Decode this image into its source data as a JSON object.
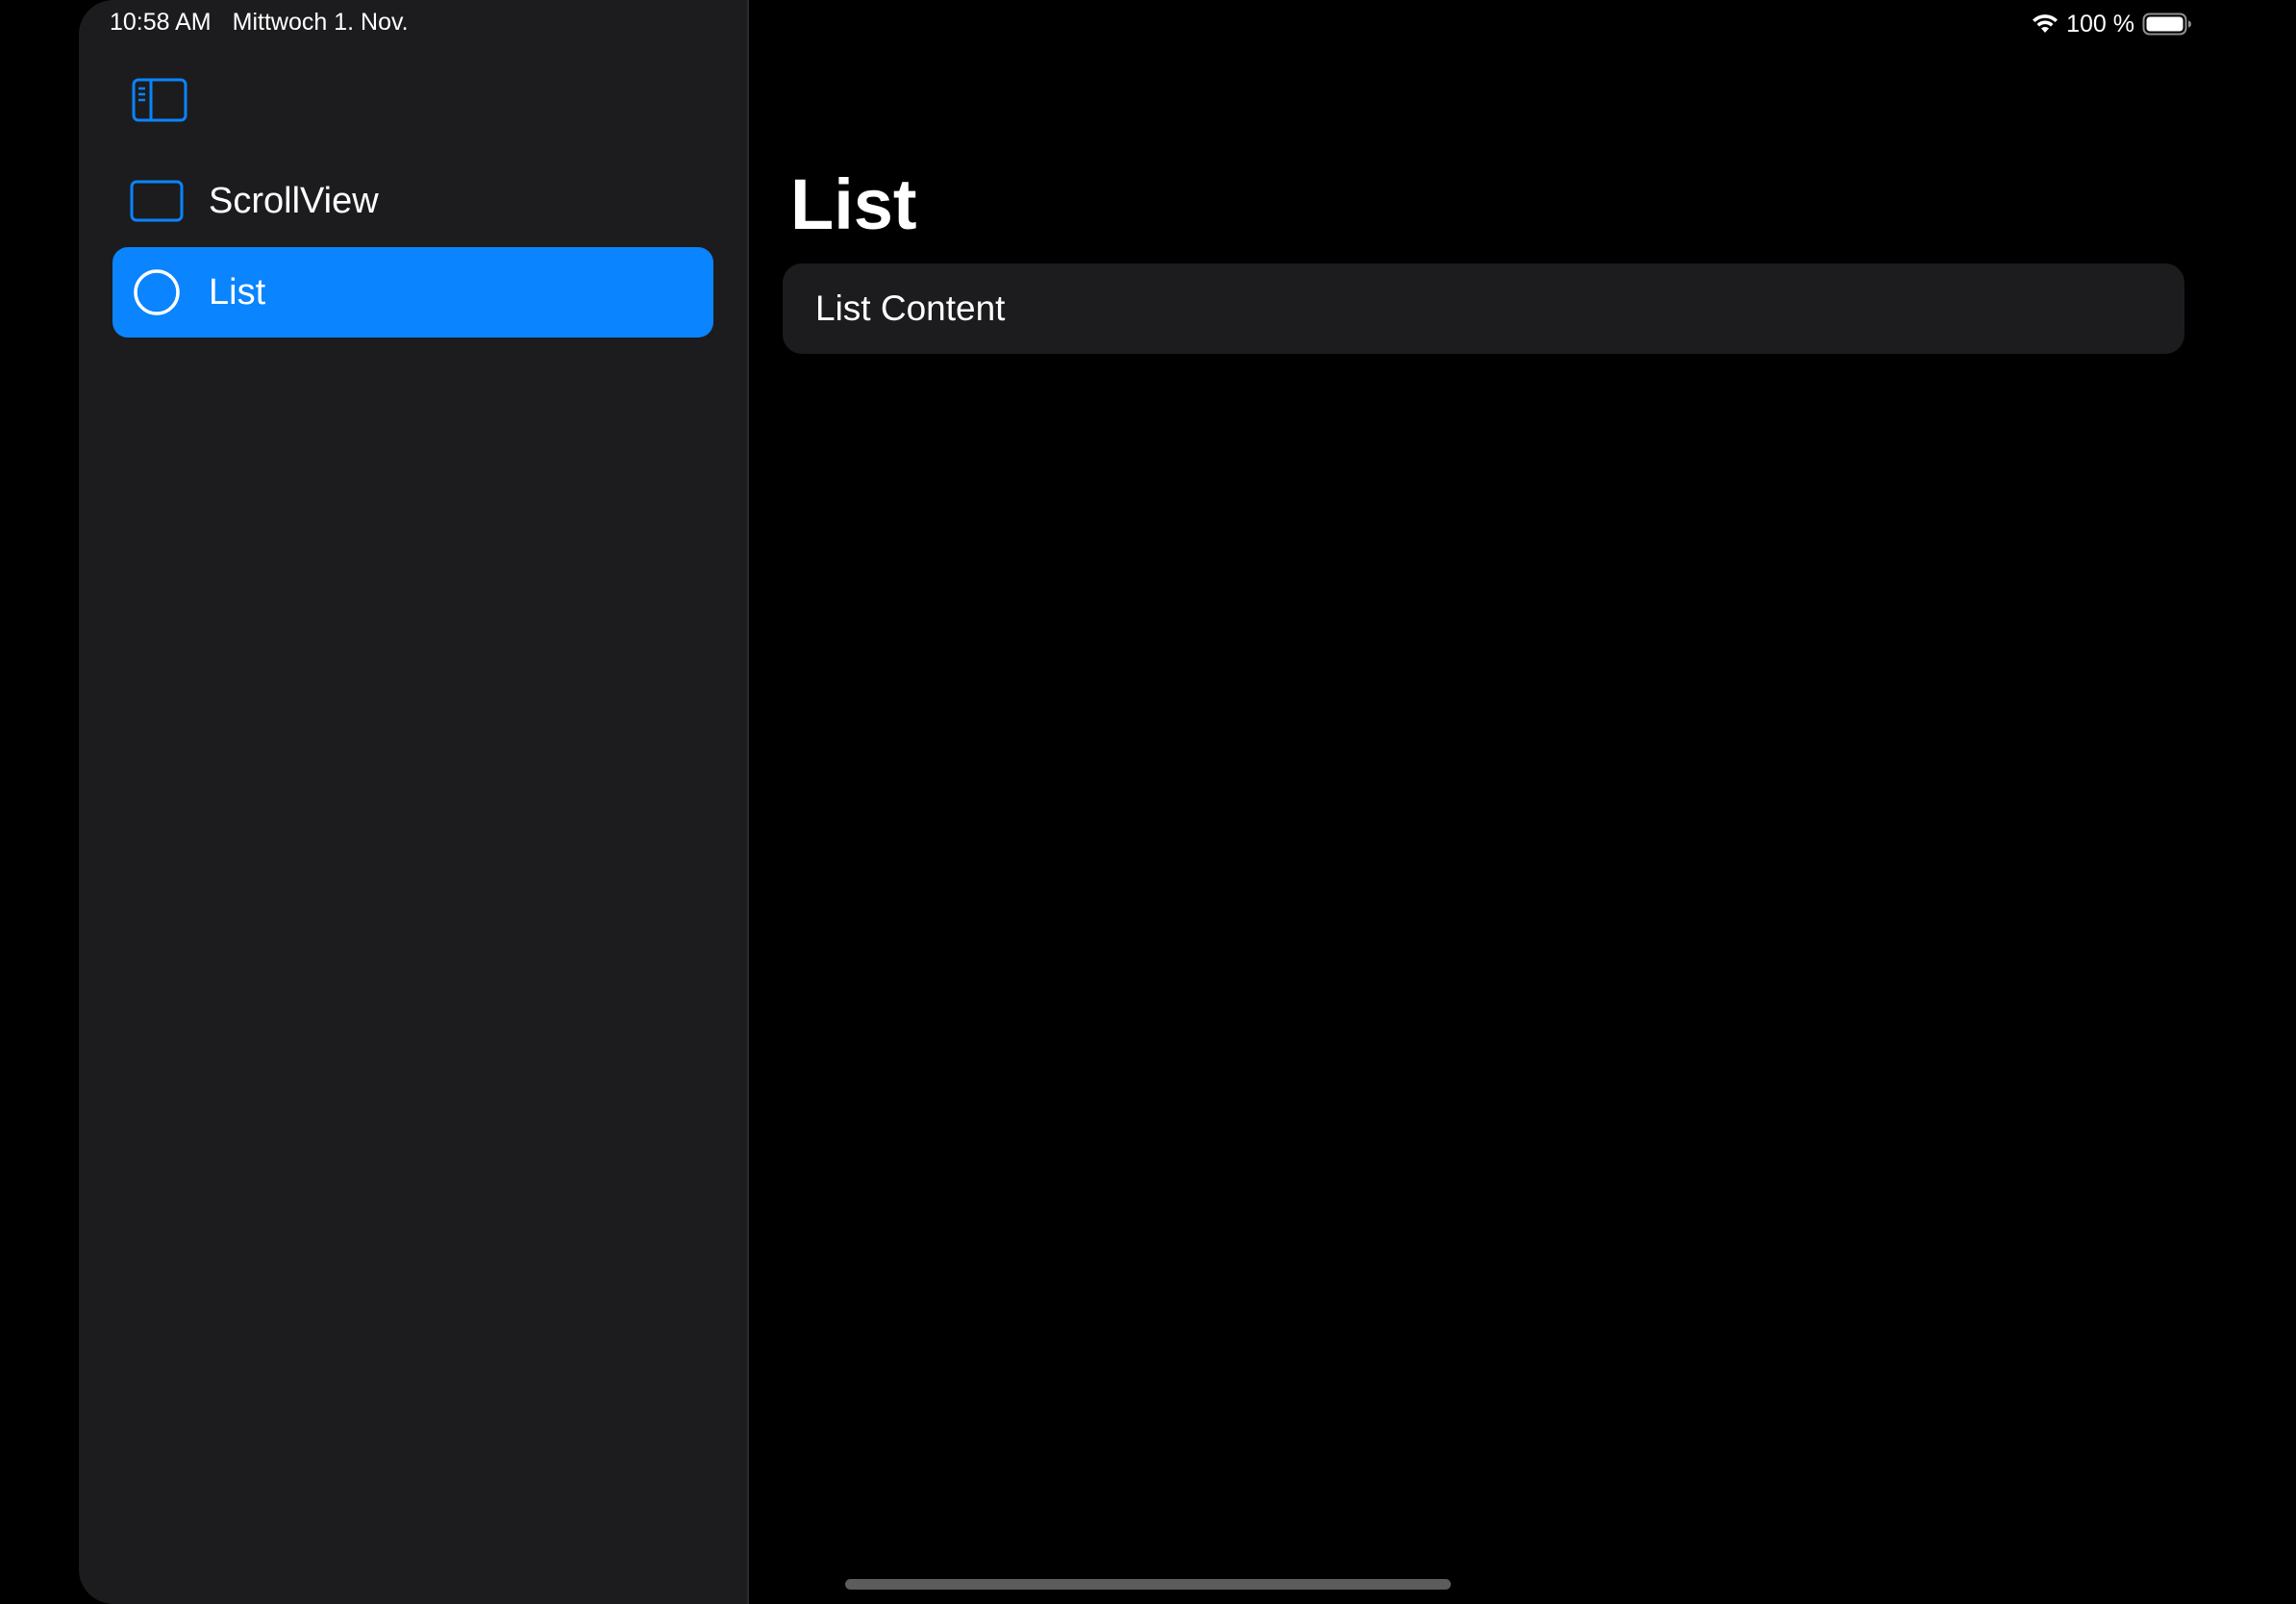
{
  "status_bar": {
    "time": "10:58 AM",
    "date": "Mittwoch 1. Nov.",
    "battery_text": "100 %",
    "wifi_icon": "wifi-icon",
    "battery_icon": "battery-full-icon"
  },
  "sidebar": {
    "toggle_icon": "sidebar-left-icon",
    "items": [
      {
        "label": "ScrollView",
        "icon": "rectangle-icon",
        "selected": false
      },
      {
        "label": "List",
        "icon": "circle-icon",
        "selected": true
      }
    ]
  },
  "detail": {
    "title": "List",
    "rows": [
      {
        "label": "List Content"
      }
    ]
  },
  "colors": {
    "accent": "#0a84ff",
    "background": "#000000",
    "sidebar_background": "#1c1c1e",
    "card_background": "#1c1c1e",
    "text": "#ffffff"
  }
}
